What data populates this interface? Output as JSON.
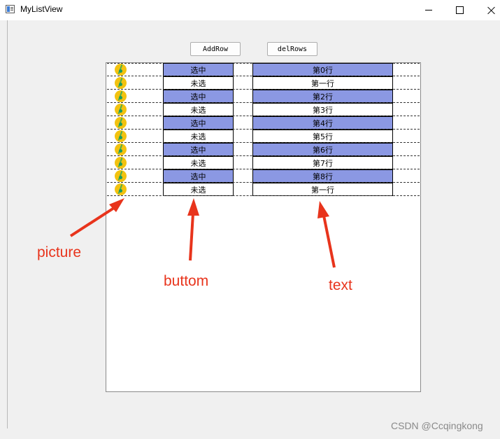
{
  "window": {
    "title": "MyListView"
  },
  "toolbar": {
    "add_row_label": "AddRow",
    "del_rows_label": "delRows"
  },
  "list": {
    "rows": [
      {
        "button": "选中",
        "text": "第0行",
        "selected": true
      },
      {
        "button": "未选",
        "text": "第一行",
        "selected": false
      },
      {
        "button": "选中",
        "text": "第2行",
        "selected": true
      },
      {
        "button": "未选",
        "text": "第3行",
        "selected": false
      },
      {
        "button": "选中",
        "text": "第4行",
        "selected": true
      },
      {
        "button": "未选",
        "text": "第5行",
        "selected": false
      },
      {
        "button": "选中",
        "text": "第6行",
        "selected": true
      },
      {
        "button": "未选",
        "text": "第7行",
        "selected": false
      },
      {
        "button": "选中",
        "text": "第8行",
        "selected": true
      },
      {
        "button": "未选",
        "text": "第一行",
        "selected": false
      }
    ],
    "selected_color": "#8b98e3",
    "unselected_color": "#ffffff"
  },
  "annotations": {
    "picture": "picture",
    "buttom": "buttom",
    "text": "text",
    "color": "#e8341c"
  },
  "watermark": "CSDN @Ccqingkong"
}
